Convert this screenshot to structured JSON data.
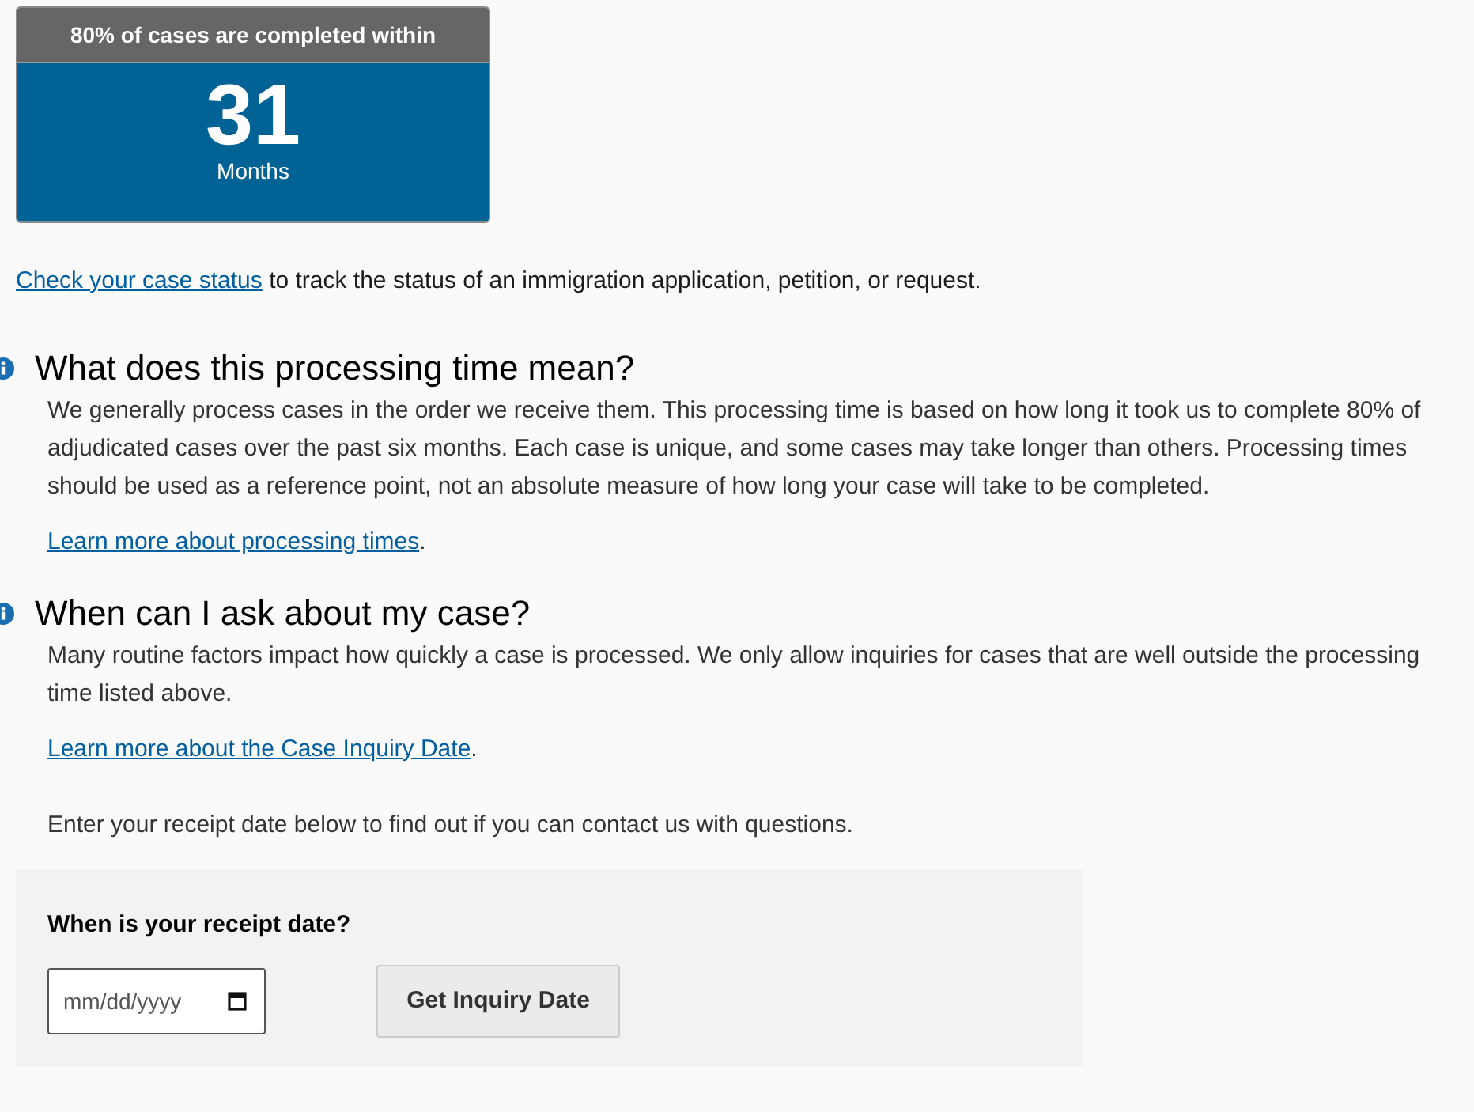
{
  "stat_card": {
    "header": "80% of cases are completed within",
    "value": "31",
    "unit": "Months"
  },
  "status_line": {
    "link": "Check your case status",
    "text": " to track the status of an immigration application, petition, or request."
  },
  "sections": [
    {
      "heading": "What does this processing time mean?",
      "paragraphs": [
        "We generally process cases in the order we receive them. This processing time is based on how long it took us to complete 80% of adjudicated cases over the past six months. Each case is unique, and some cases may take longer than others. Processing times should be used as a reference point, not an absolute measure of how long your case will take to be completed."
      ],
      "link": "Learn more about processing times",
      "link_suffix": "."
    },
    {
      "heading": "When can I ask about my case?",
      "paragraphs": [
        "Many routine factors impact how quickly a case is processed. We only allow inquiries for cases that are well outside the processing time listed above."
      ],
      "link": "Learn more about the Case Inquiry Date",
      "link_suffix": ".",
      "after": "Enter your receipt date below to find out if you can contact us with questions."
    }
  ],
  "form": {
    "label": "When is your receipt date?",
    "date_field": {
      "placeholder": "mm/dd/yyyy"
    },
    "button": "Get Inquiry Date"
  }
}
